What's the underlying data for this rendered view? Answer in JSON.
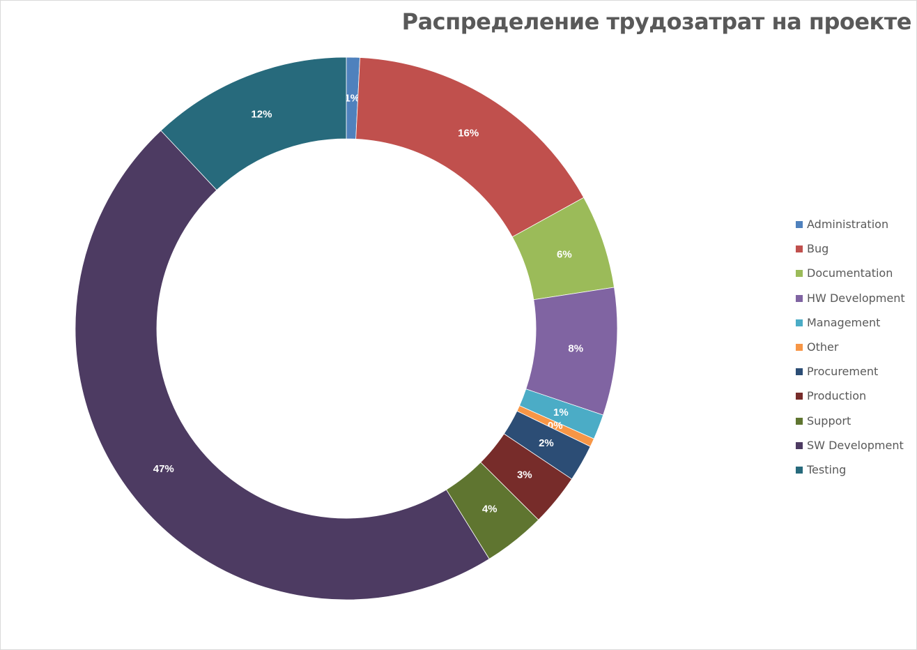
{
  "chart_data": {
    "type": "pie",
    "donut": true,
    "title": "Распределение трудозатрат на проекте",
    "legend_position": "right",
    "categories": [
      "Administration",
      "Bug",
      "Documentation",
      "HW Development",
      "Management",
      "Other",
      "Procurement",
      "Production",
      "Support",
      "SW Development",
      "Testing"
    ],
    "values": [
      0.8,
      16.2,
      5.6,
      7.6,
      1.5,
      0.5,
      2.2,
      3.1,
      3.7,
      46.9,
      12.0
    ],
    "labels": [
      "1%",
      "16%",
      "6%",
      "8%",
      "1%",
      "0%",
      "2%",
      "3%",
      "4%",
      "47%",
      "12%"
    ],
    "colors": [
      "#4f81bd",
      "#c0504d",
      "#9bbb59",
      "#8064a2",
      "#4bacc6",
      "#f79646",
      "#2c4d75",
      "#772c2a",
      "#5f7530",
      "#4d3b62",
      "#276a7c"
    ]
  }
}
